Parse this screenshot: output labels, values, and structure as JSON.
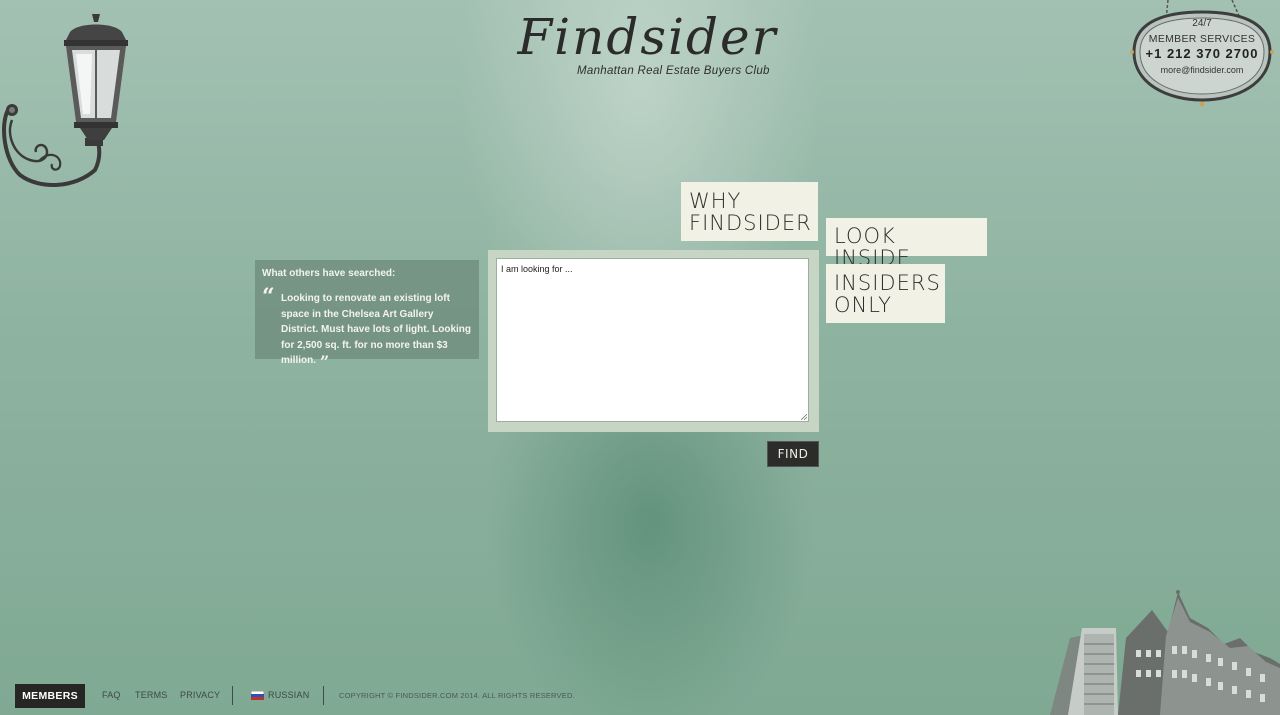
{
  "brand": {
    "name": "Findsider",
    "tagline": "Manhattan Real Estate Buyers Club"
  },
  "services": {
    "hours": "24/7",
    "label": "MEMBER SERVICES",
    "phone": "+1 212 370 2700",
    "email": "more@findsider.com"
  },
  "nav": {
    "why_line1": "WHY",
    "why_line2": "FINDSIDER",
    "look_inside": "LOOK INSIDE",
    "insiders_line1": "INSIDERS",
    "insiders_line2": "ONLY"
  },
  "others": {
    "title": "What others have searched:",
    "open_quote": "“",
    "quote": "Looking to renovate an existing loft space in the Chelsea Art Gallery District. Must have lots of light. Looking for 2,500 sq. ft. for no more than $3 million.",
    "close_quote": "”"
  },
  "search": {
    "placeholder": "I am looking for ...",
    "value": "",
    "button": "FIND"
  },
  "footer": {
    "members": "MEMBERS",
    "faq": "FAQ",
    "terms": "TERMS",
    "privacy": "PRIVACY",
    "language": "RUSSIAN",
    "copyright": "COPYRIGHT © FINDSIDER.COM 2014. ALL RIGHTS RESERVED."
  },
  "colors": {
    "background": "#8fb3a1",
    "nav_box": "#f1f1e6",
    "dark_button": "#2c2c2a",
    "search_frame": "#c7d5c5"
  },
  "icons": [
    "street-lamp-illustration",
    "hanging-plaque",
    "flag-russia-icon",
    "building-illustration",
    "resize-grip-icon"
  ]
}
